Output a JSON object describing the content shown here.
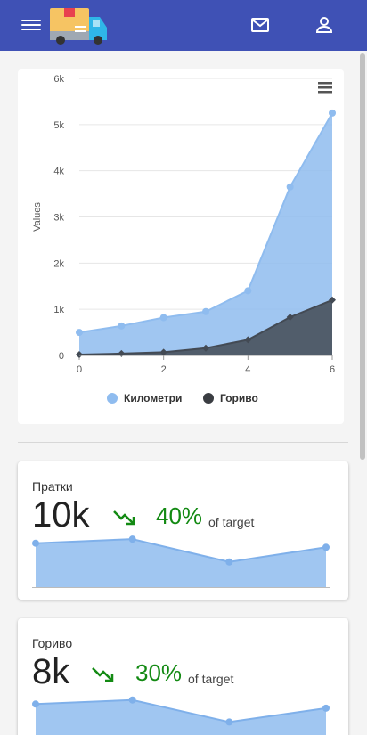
{
  "header": {
    "menu_icon": "hamburger-menu-icon",
    "logo": "delivery-truck-logo",
    "mail_icon": "mail-icon",
    "user_icon": "user-account-icon",
    "bar_color": "#3f51b5"
  },
  "chart_data": {
    "type": "area",
    "x": [
      0,
      1,
      2,
      3,
      4,
      5,
      6
    ],
    "series": [
      {
        "name": "Километри",
        "values": [
          500,
          640,
          820,
          950,
          1400,
          3650,
          5250
        ],
        "color": "#8fbcef"
      },
      {
        "name": "Гориво",
        "values": [
          20,
          40,
          70,
          160,
          340,
          830,
          1200
        ],
        "color": "#434a54"
      }
    ],
    "y_ticks": [
      "0",
      "1k",
      "2k",
      "3k",
      "4k",
      "5k",
      "6k"
    ],
    "x_ticks": [
      "0",
      "2",
      "4",
      "6"
    ],
    "ylabel": "Values",
    "ylim": [
      0,
      6000
    ],
    "xlim": [
      0,
      6
    ],
    "grid": true,
    "legend_position": "bottom",
    "menu_icon": "chart-menu-icon"
  },
  "stats": [
    {
      "title": "Пратки",
      "value": "10k",
      "percent": "40%",
      "target_label": "of target",
      "trend_icon": "trend-down-arrow-icon",
      "sparkline": [
        55,
        60,
        32,
        50
      ]
    },
    {
      "title": "Гориво",
      "value": "8k",
      "percent": "30%",
      "target_label": "of target",
      "trend_icon": "trend-down-arrow-icon",
      "sparkline": [
        50,
        55,
        28,
        45
      ]
    }
  ]
}
